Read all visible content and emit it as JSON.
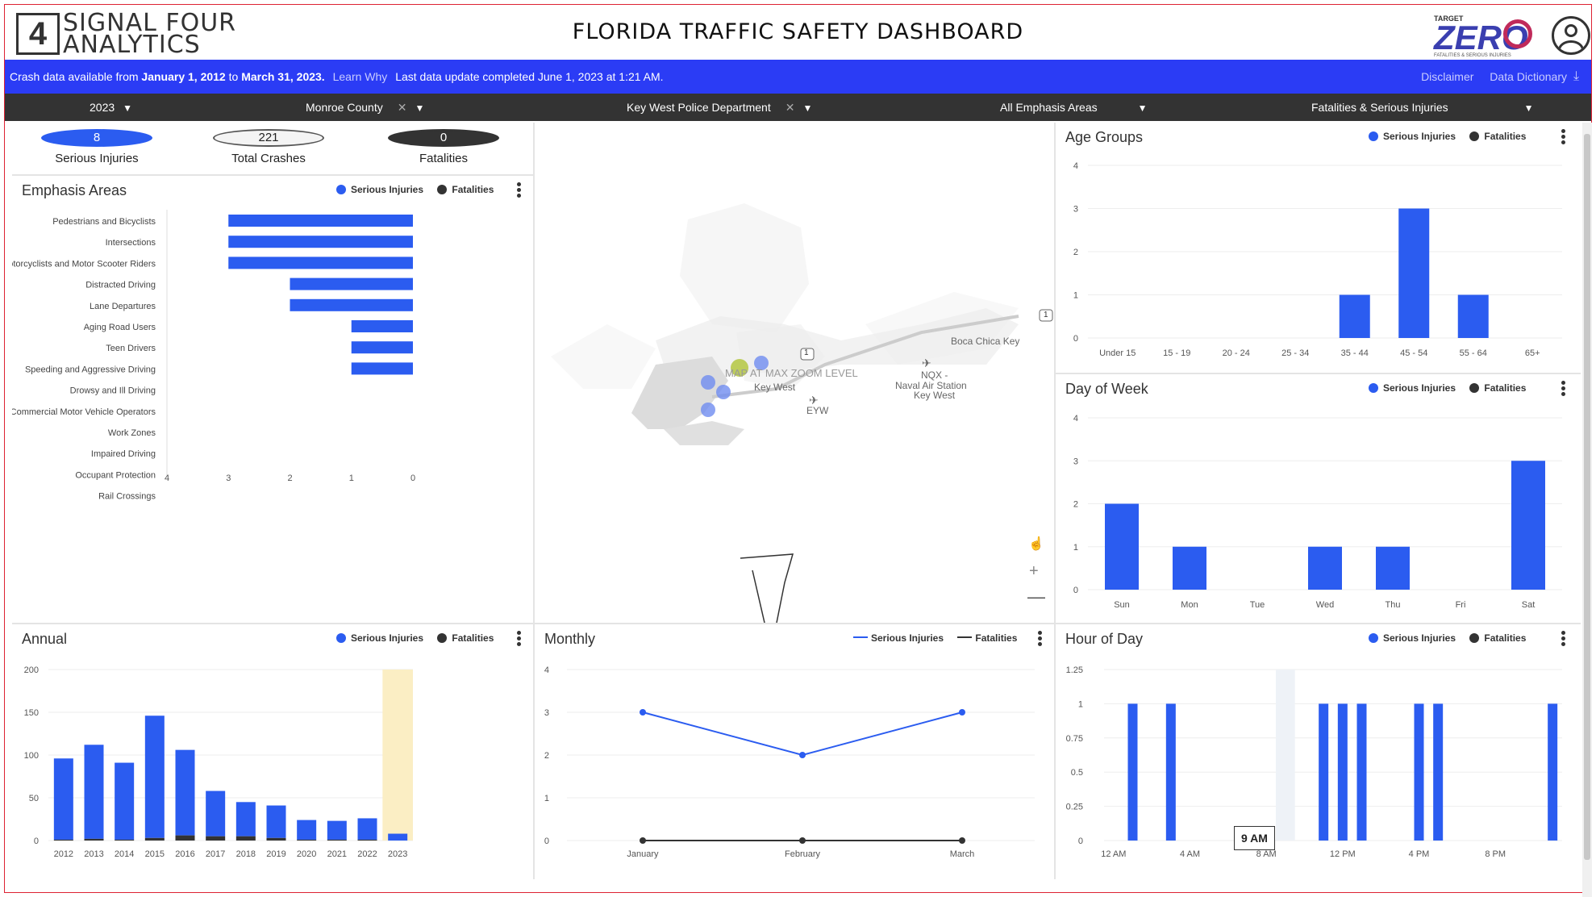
{
  "header": {
    "logo_line1": "SIGNAL FOUR",
    "logo_line2": "ANALYTICS",
    "title": "FLORIDA TRAFFIC SAFETY DASHBOARD",
    "target_zero": {
      "top": "TARGET",
      "main": "ZERO",
      "sub": "FATALITIES & SERIOUS INJURIES"
    }
  },
  "infobar": {
    "prefix": "Crash data available from",
    "start_date": "January 1, 2012",
    "mid": "to",
    "end_date": "March 31, 2023.",
    "learn_why": "Learn Why",
    "update": "Last data update completed June 1, 2023 at 1:21 AM.",
    "disclaimer": "Disclaimer",
    "data_dictionary": "Data Dictionary"
  },
  "filters": {
    "year": "2023",
    "county": "Monroe County",
    "agency": "Key West Police Department",
    "emphasis": "All Emphasis Areas",
    "severity": "Fatalities & Serious Injuries"
  },
  "stats": {
    "serious_injuries": {
      "value": "8",
      "label": "Serious Injuries"
    },
    "total_crashes": {
      "value": "221",
      "label": "Total Crashes"
    },
    "fatalities": {
      "value": "0",
      "label": "Fatalities"
    }
  },
  "legend": {
    "serious": "Serious Injuries",
    "fatal": "Fatalities"
  },
  "colors": {
    "blue": "#2b5cf0",
    "dark": "#333333",
    "highlight": "#fbeec4"
  },
  "emphasis": {
    "title": "Emphasis Areas",
    "chart_data": {
      "type": "bar",
      "orientation": "horizontal",
      "categories": [
        "Pedestrians and Bicyclists",
        "Intersections",
        "Motorcyclists and Motor Scooter Riders",
        "Distracted Driving",
        "Lane Departures",
        "Aging Road Users",
        "Teen Drivers",
        "Speeding and Aggressive Driving",
        "Drowsy and Ill Driving",
        "Commercial Motor Vehicle Operators",
        "Work Zones",
        "Impaired Driving",
        "Occupant Protection",
        "Rail Crossings"
      ],
      "series": [
        {
          "name": "Serious Injuries",
          "values": [
            3,
            3,
            3,
            2,
            2,
            1,
            1,
            1,
            0,
            0,
            0,
            0,
            0,
            0
          ]
        }
      ],
      "xlim": [
        0,
        4
      ],
      "ticks": [
        "4",
        "3",
        "2",
        "1",
        "0"
      ],
      "reversed": true
    }
  },
  "map": {
    "max_zoom_label": "MAP AT MAX ZOOM LEVEL",
    "key_west": "Key West",
    "eyw": "EYW",
    "nqx": "NQX -",
    "naval": "Naval Air Station",
    "naval2": "Key West",
    "boca": "Boca Chica Key",
    "route": "1"
  },
  "age": {
    "title": "Age Groups",
    "chart_data": {
      "type": "bar",
      "categories": [
        "Under 15",
        "15 - 19",
        "20 - 24",
        "25 - 34",
        "35 - 44",
        "45 - 54",
        "55 - 64",
        "65+"
      ],
      "series": [
        {
          "name": "Serious Injuries",
          "values": [
            0,
            0,
            0,
            0,
            1,
            3,
            1,
            0
          ]
        }
      ],
      "ylim": [
        0,
        4
      ],
      "yticks": [
        "4",
        "3",
        "2",
        "1",
        "0"
      ]
    }
  },
  "dow": {
    "title": "Day of Week",
    "chart_data": {
      "type": "bar",
      "categories": [
        "Sun",
        "Mon",
        "Tue",
        "Wed",
        "Thu",
        "Fri",
        "Sat"
      ],
      "series": [
        {
          "name": "Serious Injuries",
          "values": [
            2,
            1,
            0,
            1,
            1,
            0,
            3
          ]
        }
      ],
      "ylim": [
        0,
        4
      ],
      "yticks": [
        "4",
        "3",
        "2",
        "1",
        "0"
      ]
    }
  },
  "annual": {
    "title": "Annual",
    "chart_data": {
      "type": "bar",
      "stacked": true,
      "categories": [
        "2012",
        "2013",
        "2014",
        "2015",
        "2016",
        "2017",
        "2018",
        "2019",
        "2020",
        "2021",
        "2022",
        "2023"
      ],
      "series": [
        {
          "name": "Serious Injuries",
          "values": [
            95,
            110,
            90,
            143,
            100,
            53,
            40,
            38,
            23,
            22,
            25,
            8
          ]
        },
        {
          "name": "Fatalities",
          "values": [
            1,
            2,
            1,
            3,
            6,
            5,
            5,
            3,
            1,
            1,
            1,
            0
          ]
        }
      ],
      "highlight": "2023",
      "ylim": [
        0,
        200
      ],
      "yticks": [
        "200",
        "150",
        "100",
        "50",
        "0"
      ]
    }
  },
  "monthly": {
    "title": "Monthly",
    "chart_data": {
      "type": "line",
      "categories": [
        "January",
        "February",
        "March"
      ],
      "series": [
        {
          "name": "Serious Injuries",
          "values": [
            3,
            2,
            3
          ]
        },
        {
          "name": "Fatalities",
          "values": [
            0,
            0,
            0
          ]
        }
      ],
      "ylim": [
        0,
        4
      ],
      "yticks": [
        "4",
        "3",
        "2",
        "1",
        "0"
      ]
    }
  },
  "hour": {
    "title": "Hour of Day",
    "tooltip": "9 AM",
    "chart_data": {
      "type": "bar",
      "categories": [
        "12 AM",
        "1 AM",
        "2 AM",
        "3 AM",
        "4 AM",
        "5 AM",
        "6 AM",
        "7 AM",
        "8 AM",
        "9 AM",
        "10 AM",
        "11 AM",
        "12 PM",
        "1 PM",
        "2 PM",
        "3 PM",
        "4 PM",
        "5 PM",
        "6 PM",
        "7 PM",
        "8 PM",
        "9 PM",
        "10 PM",
        "11 PM"
      ],
      "series": [
        {
          "name": "Serious Injuries",
          "values": [
            0,
            1,
            0,
            1,
            0,
            0,
            0,
            0,
            0,
            0,
            0,
            1,
            1,
            1,
            0,
            0,
            1,
            1,
            0,
            0,
            0,
            0,
            0,
            1
          ]
        }
      ],
      "highlight": "9 AM",
      "xtick_labels": [
        "12 AM",
        "4 AM",
        "8 AM",
        "12 PM",
        "4 PM",
        "8 PM"
      ],
      "ylim": [
        0,
        1.25
      ],
      "yticks": [
        "1.25",
        "1",
        "0.75",
        "0.5",
        "0.25",
        "0"
      ]
    }
  }
}
